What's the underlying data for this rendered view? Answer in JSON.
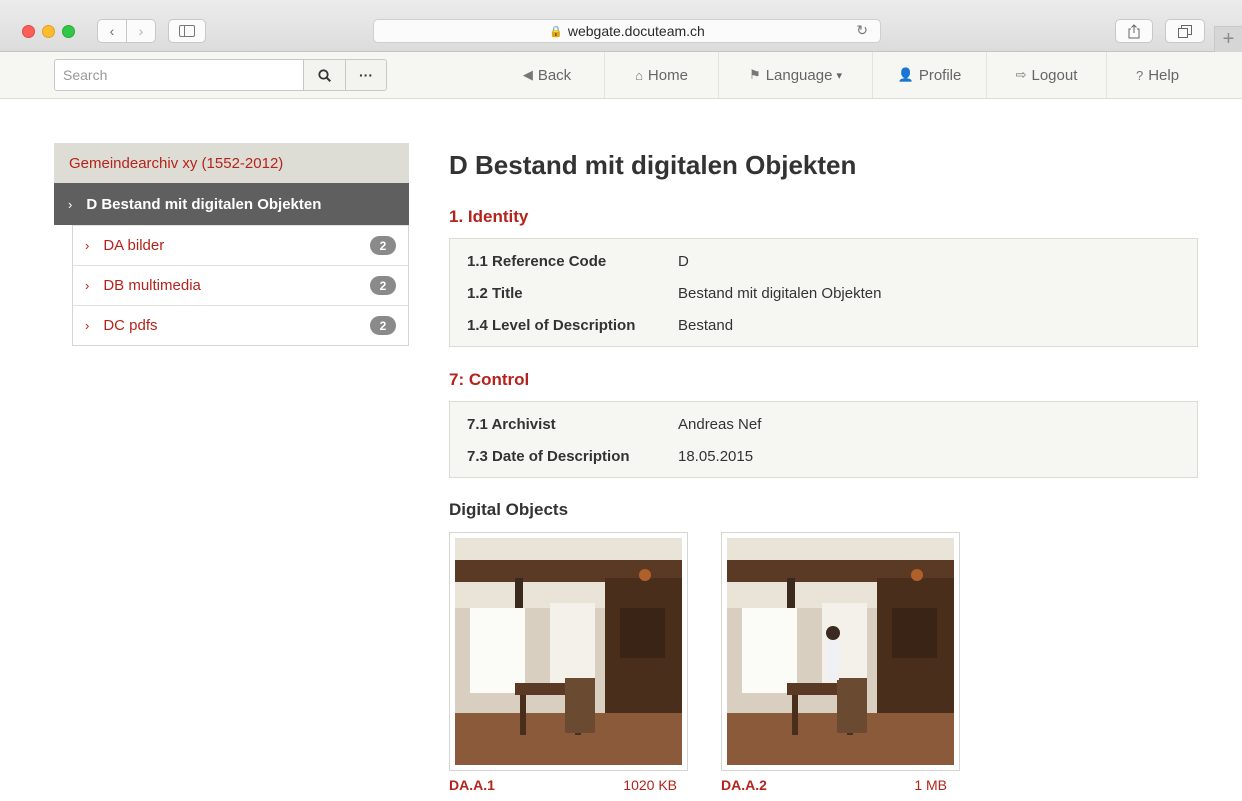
{
  "browser": {
    "url": "webgate.docuteam.ch"
  },
  "navbar": {
    "search_placeholder": "Search",
    "items": [
      {
        "label": "Back",
        "icon": "arrow-left-icon"
      },
      {
        "label": "Home",
        "icon": "home-icon"
      },
      {
        "label": "Language",
        "icon": "flag-icon",
        "caret": "▾"
      },
      {
        "label": "Profile",
        "icon": "user-icon"
      },
      {
        "label": "Logout",
        "icon": "sign-out-icon"
      },
      {
        "label": "Help",
        "icon": "question-circle-icon"
      }
    ]
  },
  "sidebar": {
    "root": "Gemeindearchiv xy (1552-2012)",
    "active": "D Bestand mit digitalen Objekten",
    "children": [
      {
        "label": "DA bilder",
        "count": "2"
      },
      {
        "label": "DB multimedia",
        "count": "2"
      },
      {
        "label": "DC pdfs",
        "count": "2"
      }
    ]
  },
  "main": {
    "title": "D Bestand mit digitalen Objekten",
    "identity": {
      "title": "1. Identity",
      "rows": [
        {
          "key": "1.1 Reference Code",
          "value": "D"
        },
        {
          "key": "1.2 Title",
          "value": "Bestand mit digitalen Objekten"
        },
        {
          "key": "1.4 Level of Description",
          "value": "Bestand"
        }
      ]
    },
    "control": {
      "title": "7: Control",
      "rows": [
        {
          "key": "7.1 Archivist",
          "value": "Andreas Nef"
        },
        {
          "key": "7.3 Date of Description",
          "value": "18.05.2015"
        }
      ]
    },
    "digital_objects": {
      "title": "Digital Objects",
      "items": [
        {
          "name": "DA.A.1",
          "size": "1020 KB"
        },
        {
          "name": "DA.A.2",
          "size": "1 MB"
        }
      ]
    }
  },
  "colors": {
    "accent": "#b5231c",
    "active_bg": "#5f5f5f",
    "box_bg": "#f6f6f2"
  }
}
